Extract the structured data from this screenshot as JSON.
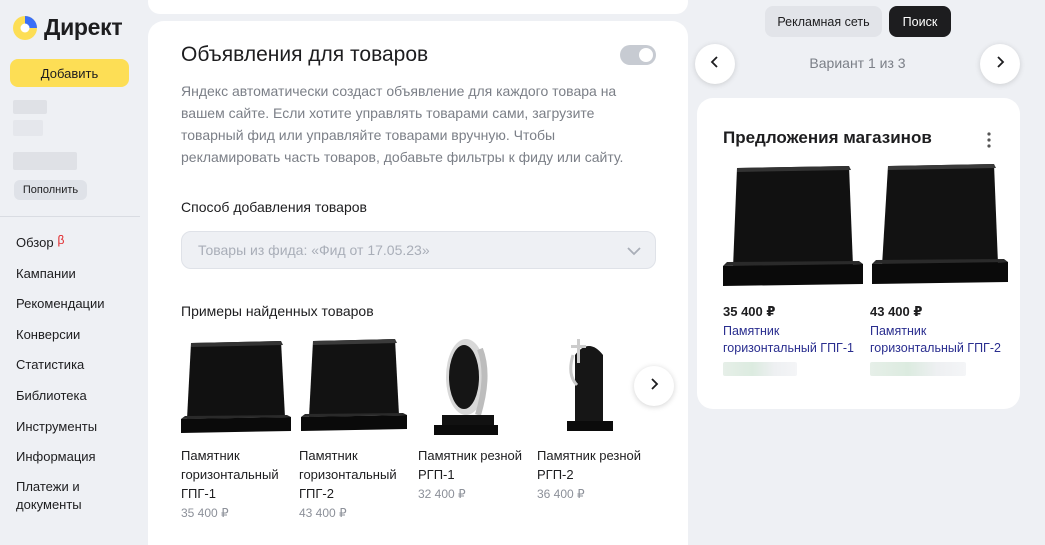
{
  "app": {
    "logo_text": "Директ",
    "brand_color": "#fdde55"
  },
  "sidebar": {
    "add_button": "Добавить",
    "topup_button": "Пополнить",
    "beta_badge": "β",
    "items": [
      {
        "label": "Обзор"
      },
      {
        "label": "Кампании"
      },
      {
        "label": "Рекомендации"
      },
      {
        "label": "Конверсии"
      },
      {
        "label": "Статистика"
      },
      {
        "label": "Библиотека"
      },
      {
        "label": "Инструменты"
      },
      {
        "label": "Информация"
      },
      {
        "label": "Платежи и документы"
      }
    ]
  },
  "main": {
    "title": "Объявления для товаров",
    "toggle_on": false,
    "description": "Яндекс автоматически создаст объявление для каждого товара на вашем сайте. Если хотите управлять товарами сами, загрузите товарный фид или управляйте товарами вручную. Чтобы рекламировать часть товаров, добавьте фильтры к фиду или сайту.",
    "method_label": "Способ добавления товаров",
    "method_value": "Товары из фида: «Фид от 17.05.23»",
    "examples_label": "Примеры найденных товаров",
    "products": [
      {
        "name": "Памятник горизонтальный ГПГ-1",
        "price": "35 400 ₽"
      },
      {
        "name": "Памятник горизонтальный ГПГ-2",
        "price": "43 400 ₽"
      },
      {
        "name": "Памятник резной РГП-1",
        "price": "32 400 ₽"
      },
      {
        "name": "Памятник резной РГП-2",
        "price": "36 400 ₽"
      }
    ]
  },
  "preview": {
    "tabs": [
      "Рекламная сеть",
      "Поиск"
    ],
    "active_tab": "Поиск",
    "variant": "Вариант 1 из 3",
    "card_title": "Предложения магазинов",
    "offers": [
      {
        "price": "35 400 ₽",
        "name": "Памятник горизонтальный ГПГ-1"
      },
      {
        "price": "43 400 ₽",
        "name": "Памятник горизонтальный ГПГ-2"
      }
    ],
    "link_color": "#2a2e8f"
  }
}
